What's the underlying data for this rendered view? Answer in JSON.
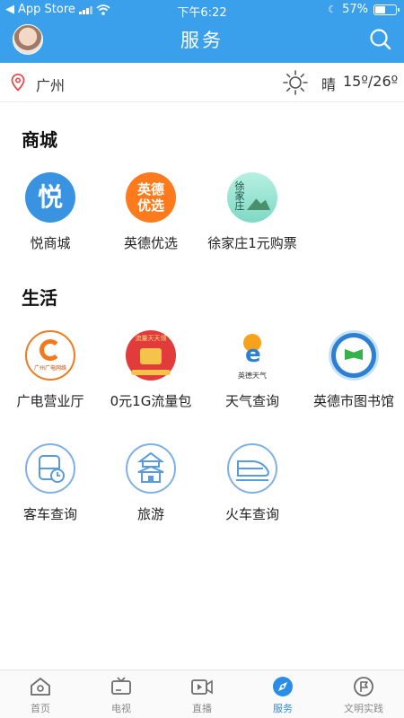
{
  "status_bar": {
    "back_app": "App Store",
    "time": "下午6:22",
    "battery": "57%",
    "battery_level": 0.57
  },
  "nav": {
    "title": "服务"
  },
  "location": {
    "city": "广州",
    "weather": "晴",
    "temperature": "15º/26º"
  },
  "mall": {
    "title": "商城",
    "items": [
      {
        "label": "悦商城",
        "icon_text": "悦",
        "icon": "yue-mall-icon"
      },
      {
        "label": "英德优选",
        "icon_text": "英德\n优选",
        "icon": "yingde-youxuan-icon"
      },
      {
        "label": "徐家庄1元购票",
        "icon_text": "徐家庄",
        "icon": "xujiazhuang-icon"
      }
    ]
  },
  "life": {
    "title": "生活",
    "items": [
      {
        "label": "广电营业厅",
        "icon_text": "广州广电网络",
        "icon": "guangdian-icon"
      },
      {
        "label": "0元1G流量包",
        "icon_text": "流量天天领",
        "icon": "data-package-icon"
      },
      {
        "label": "天气查询",
        "icon_text": "英德天气",
        "icon": "weather-query-icon"
      },
      {
        "label": "英德市图书馆",
        "icon": "library-icon"
      },
      {
        "label": "客车查询",
        "icon": "bus-icon"
      },
      {
        "label": "旅游",
        "icon": "temple-icon"
      },
      {
        "label": "火车查询",
        "icon": "train-icon"
      }
    ]
  },
  "tabbar": {
    "tabs": [
      {
        "label": "首页",
        "icon": "home-icon"
      },
      {
        "label": "电视",
        "icon": "tv-icon"
      },
      {
        "label": "直播",
        "icon": "live-icon"
      },
      {
        "label": "服务",
        "icon": "compass-icon",
        "active": true
      },
      {
        "label": "文明实践",
        "icon": "flag-icon"
      }
    ]
  },
  "colors": {
    "header": "#3aa0ec",
    "active_tab": "#2b8ee6",
    "inactive_tab": "#8a8a8a"
  }
}
